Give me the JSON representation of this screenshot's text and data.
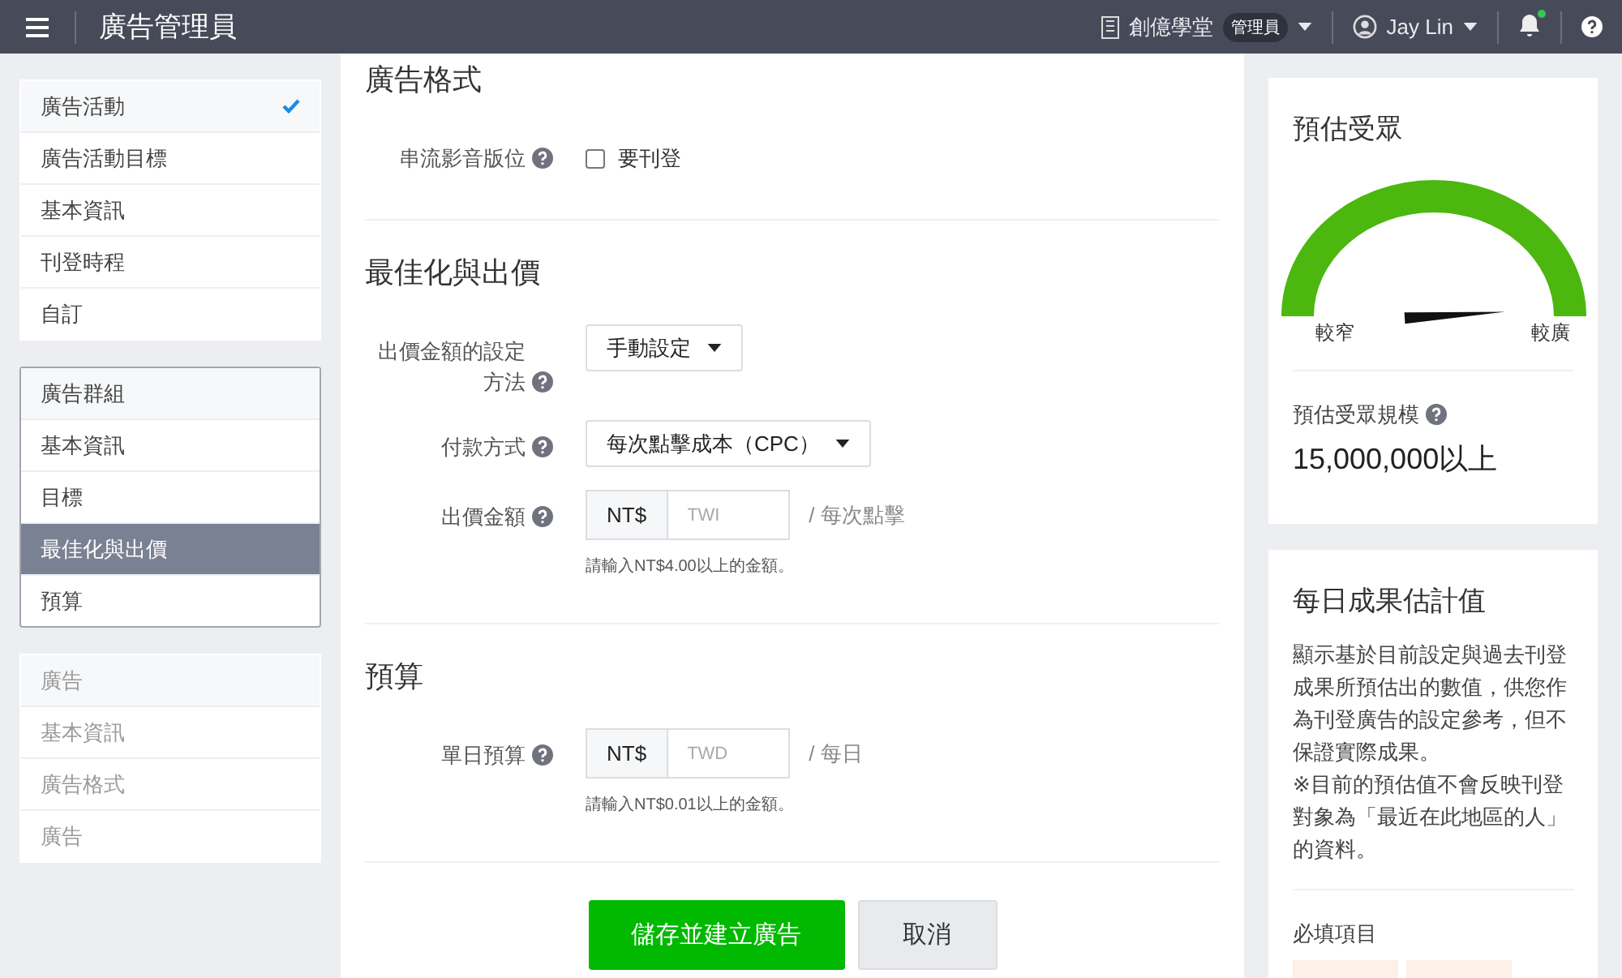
{
  "topbar": {
    "title": "廣告管理員",
    "account": "創億學堂",
    "role_badge": "管理員",
    "user": "Jay Lin",
    "has_notification": true
  },
  "sidebar": {
    "groups": [
      {
        "active": false,
        "disabled": false,
        "items": [
          {
            "label": "廣告活動",
            "kind": "header",
            "checked": true,
            "selected": false
          },
          {
            "label": "廣告活動目標",
            "kind": "item",
            "checked": false,
            "selected": false
          },
          {
            "label": "基本資訊",
            "kind": "item",
            "checked": false,
            "selected": false
          },
          {
            "label": "刊登時程",
            "kind": "item",
            "checked": false,
            "selected": false
          },
          {
            "label": "自訂",
            "kind": "item",
            "checked": false,
            "selected": false
          }
        ]
      },
      {
        "active": true,
        "disabled": false,
        "items": [
          {
            "label": "廣告群組",
            "kind": "header",
            "checked": false,
            "selected": false
          },
          {
            "label": "基本資訊",
            "kind": "item",
            "checked": false,
            "selected": false
          },
          {
            "label": "目標",
            "kind": "item",
            "checked": false,
            "selected": false
          },
          {
            "label": "最佳化與出價",
            "kind": "item",
            "checked": false,
            "selected": true
          },
          {
            "label": "預算",
            "kind": "item",
            "checked": false,
            "selected": false
          }
        ]
      },
      {
        "active": false,
        "disabled": true,
        "items": [
          {
            "label": "廣告",
            "kind": "header",
            "checked": false,
            "selected": false
          },
          {
            "label": "基本資訊",
            "kind": "item",
            "checked": false,
            "selected": false
          },
          {
            "label": "廣告格式",
            "kind": "item",
            "checked": false,
            "selected": false
          },
          {
            "label": "廣告",
            "kind": "item",
            "checked": false,
            "selected": false
          }
        ]
      }
    ]
  },
  "sections": [
    {
      "title": "廣告格式",
      "fields": [
        {
          "kind": "checkbox",
          "label": "串流影音版位",
          "help": true,
          "option": "要刊登",
          "checked": false
        }
      ]
    },
    {
      "title": "最佳化與出價",
      "fields": [
        {
          "kind": "dropdown",
          "label": "出價金額的設定方法",
          "help": true,
          "value": "手動設定"
        },
        {
          "kind": "dropdown",
          "label": "付款方式",
          "help": true,
          "value": "每次點擊成本（CPC）"
        },
        {
          "kind": "money",
          "label": "出價金額",
          "help": true,
          "prefix": "NT$",
          "placeholder": "TWI",
          "suffix": "/ 每次點擊",
          "hint": "請輸入NT$4.00以上的金額。"
        }
      ]
    },
    {
      "title": "預算",
      "fields": [
        {
          "kind": "money",
          "label": "單日預算",
          "help": true,
          "prefix": "NT$",
          "placeholder": "TWD",
          "suffix": "/ 每日",
          "hint": "請輸入NT$0.01以上的金額。"
        }
      ]
    }
  ],
  "actions": [
    {
      "label": "儲存並建立廣告",
      "kind": "primary"
    },
    {
      "label": "取消",
      "kind": "secondary"
    }
  ],
  "audience": {
    "title": "預估受眾",
    "gauge": {
      "narrow_label": "較窄",
      "wide_label": "較廣"
    },
    "size_label": "預估受眾規模",
    "size_help": true,
    "size_value": "15,000,000以上"
  },
  "estimate": {
    "title": "每日成果估計值",
    "description": "顯示基於目前設定與過去刊登成果所預估出的數值，供您作為刊登廣告的設定參考，但不保證實際成果。",
    "note": "※目前的預估值不會反映刊登對象為「最近在此地區的人」的資料。",
    "required_title": "必填項目"
  }
}
